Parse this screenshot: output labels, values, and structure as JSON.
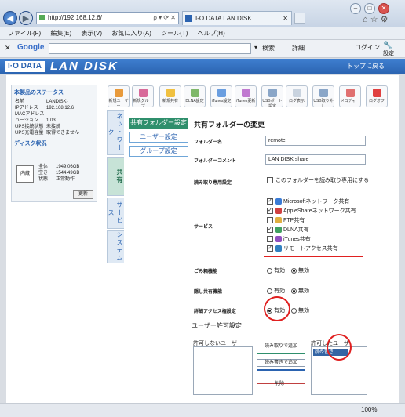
{
  "browser": {
    "url": "http://192.168.12.6/",
    "tab_title": "I-O DATA LAN DISK",
    "menu": [
      "ファイル(F)",
      "編集(E)",
      "表示(V)",
      "お気に入り(A)",
      "ツール(T)",
      "ヘルプ(H)"
    ],
    "google_label": "Google",
    "search_label": "検索",
    "detail_label": "詳細",
    "login_label": "ログイン",
    "settings_label": "設定",
    "zoom": "100%"
  },
  "header": {
    "logo": "I·O DATA",
    "product": "LAN DISK",
    "to_top": "トップに戻る"
  },
  "status": {
    "title": "本製品のステータス",
    "rows": [
      {
        "k": "名前",
        "v": "LANDISK-"
      },
      {
        "k": "IPアドレス",
        "v": "192.168.12.6"
      },
      {
        "k": "MACアドレス",
        "v": ""
      },
      {
        "k": "バージョン",
        "v": "1.03"
      },
      {
        "k": "UPS接続状態",
        "v": "未接続"
      },
      {
        "k": "UPS充電容量",
        "v": "取得できません"
      }
    ],
    "disk_title": "ディスク状況",
    "disk_label": "内蔵",
    "disk_rows": [
      {
        "k": "全体",
        "v": "1949.06GB"
      },
      {
        "k": "空き",
        "v": "1544.49GB"
      },
      {
        "k": "状態",
        "v": "正常動作"
      }
    ],
    "update_button": "更新"
  },
  "vtabs": [
    "ネットワーク",
    "共有",
    "サービス",
    "システム"
  ],
  "toolbar": [
    "新規ユーザー",
    "新規グループ",
    "新規共有",
    "DLNA設定",
    "iTunes設定",
    "iTunes更新",
    "USBポート設定",
    "ログ表示",
    "USB取り外し",
    "メロディー",
    "ログオフ"
  ],
  "side_menu": [
    "共有フォルダー設定",
    "ユーザー設定",
    "グループ設定"
  ],
  "form": {
    "title": "共有フォルダーの変更",
    "folder_name_label": "フォルダー名",
    "folder_name_value": "remote",
    "comment_label": "フォルダーコメント",
    "comment_value": "LAN DISK share",
    "readonly_label": "読み取り専用設定",
    "readonly_option": "このフォルダーを読み取り専用にする",
    "service_label": "サービス",
    "services": [
      {
        "label": "Microsoftネットワーク共有",
        "checked": true,
        "color": "#3a7bd5"
      },
      {
        "label": "AppleShareネットワーク共有",
        "checked": true,
        "color": "#d04040"
      },
      {
        "label": "FTP共有",
        "checked": false,
        "color": "#e0b040"
      },
      {
        "label": "DLNA共有",
        "checked": true,
        "color": "#40a060"
      },
      {
        "label": "iTunes共有",
        "checked": false,
        "color": "#9050c0"
      },
      {
        "label": "リモートアクセス共有",
        "checked": true,
        "color": "#3080c0"
      }
    ],
    "trash_label": "ごみ箱機能",
    "hidden_label": "隠し共有機能",
    "detail_access_label": "詳細アクセス権設定",
    "enabled": "有効",
    "disabled": "無効",
    "user_perm_label": "ユーザー許可設定",
    "denied_users_label": "許可しないユーザー",
    "allowed_users_label": "許可したユーザー",
    "read_only_btn": "読み取りで追加",
    "read_write_btn": "読み書きで追加",
    "delete_btn": "削除",
    "allowed_user_value": "読み書き"
  }
}
